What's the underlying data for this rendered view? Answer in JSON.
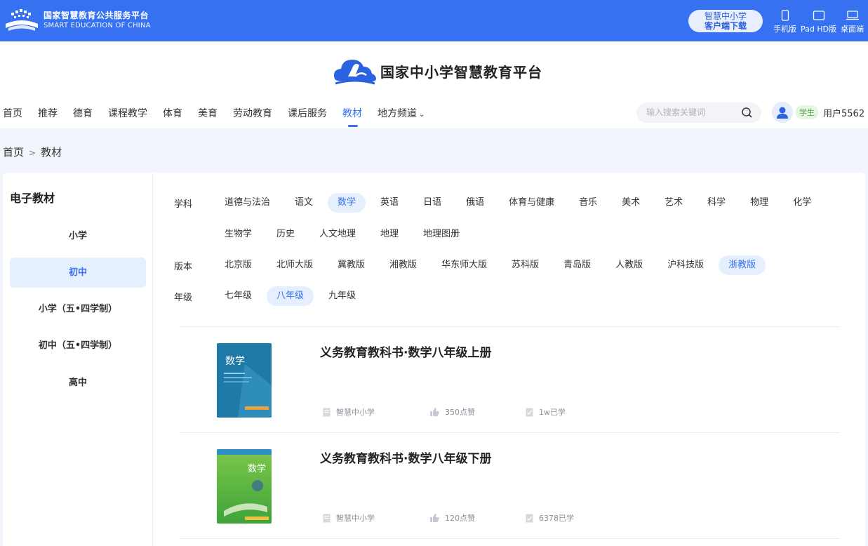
{
  "topbar": {
    "brand_cn": "国家智慧教育公共服务平台",
    "brand_en": "SMART EDUCATION OF CHINA",
    "download_line1": "智慧中小学",
    "download_line2": "客户端下载",
    "devices": [
      {
        "label": "手机版",
        "icon": "phone-icon"
      },
      {
        "label": "Pad HD版",
        "icon": "tablet-icon"
      },
      {
        "label": "桌面端",
        "icon": "laptop-icon"
      }
    ]
  },
  "header": {
    "site_title": "国家中小学智慧教育平台",
    "nav": [
      "首页",
      "推荐",
      "德育",
      "课程教学",
      "体育",
      "美育",
      "劳动教育",
      "课后服务",
      "教材",
      "地方频道"
    ],
    "active_nav": "教材",
    "search_placeholder": "输入搜索关键词",
    "role_badge": "学生",
    "username": "用户5562"
  },
  "breadcrumb": {
    "home": "首页",
    "sep": ">",
    "current": "教材"
  },
  "sidebar": {
    "title": "电子教材",
    "items": [
      "小学",
      "初中",
      "小学（五•四学制）",
      "初中（五•四学制）",
      "高中"
    ],
    "active": "初中"
  },
  "filters": {
    "subject_label": "学科",
    "subjects_row1": [
      "道德与法治",
      "语文",
      "数学",
      "英语",
      "日语",
      "俄语",
      "体育与健康",
      "音乐",
      "美术",
      "艺术",
      "科学",
      "物理",
      "化学"
    ],
    "subjects_row2": [
      "生物学",
      "历史",
      "人文地理",
      "地理",
      "地理图册"
    ],
    "subject_selected": "数学",
    "edition_label": "版本",
    "editions": [
      "北京版",
      "北师大版",
      "冀教版",
      "湘教版",
      "华东师大版",
      "苏科版",
      "青岛版",
      "人教版",
      "沪科技版",
      "浙教版"
    ],
    "edition_selected": "浙教版",
    "grade_label": "年级",
    "grades": [
      "七年级",
      "八年级",
      "九年级"
    ],
    "grade_selected": "八年级"
  },
  "books": [
    {
      "title": "义务教育教科书·数学八年级上册",
      "source": "智慧中小学",
      "likes": "350点赞",
      "learned": "1w已学",
      "cover_text": "数学"
    },
    {
      "title": "义务教育教科书·数学八年级下册",
      "source": "智慧中小学",
      "likes": "120点赞",
      "learned": "6378已学",
      "cover_text": "数学"
    }
  ],
  "colors": {
    "primary": "#3571f0",
    "selected_bg": "#e6effd",
    "page_bg": "#f2f5fb"
  }
}
